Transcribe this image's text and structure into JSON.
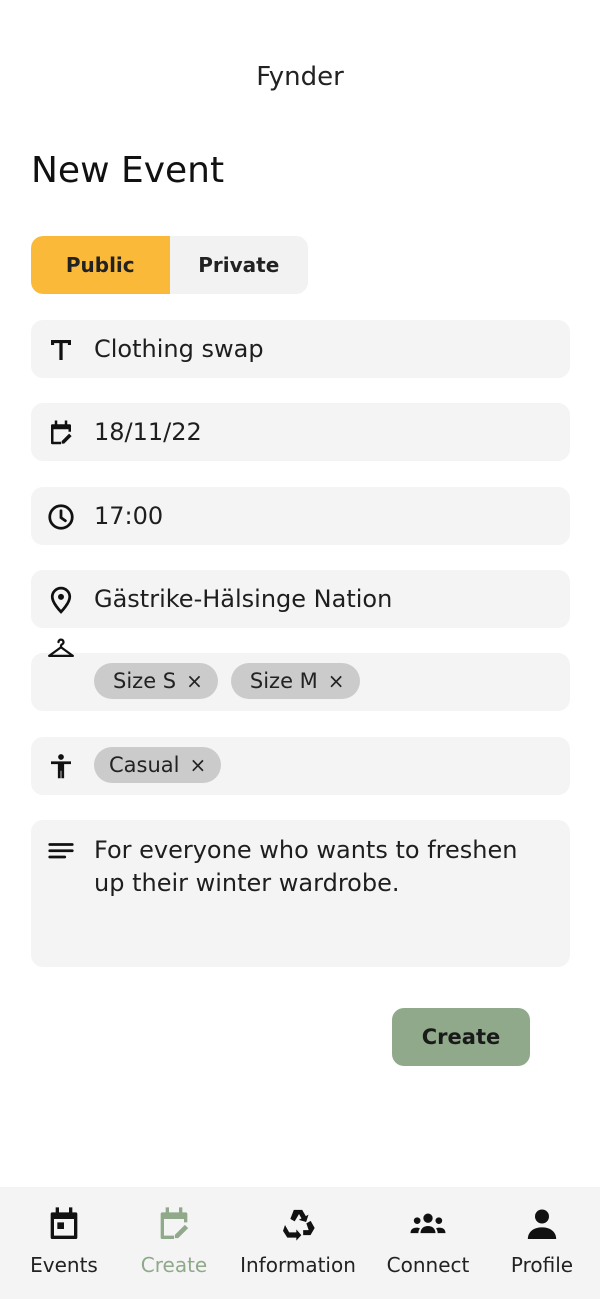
{
  "header": {
    "app_title": "Fynder"
  },
  "page": {
    "title": "New Event"
  },
  "visibility": {
    "options": [
      "Public",
      "Private"
    ],
    "selected": "Public",
    "active_color": "#fbb93a"
  },
  "form": {
    "title": "Clothing swap",
    "date": "18/11/22",
    "time": "17:00",
    "location": "Gästrike-Hälsinge Nation",
    "sizes": [
      "Size S",
      "Size M"
    ],
    "styles": [
      "Casual"
    ],
    "description": "For everyone who wants to freshen up their winter wardrobe.",
    "chip_remove_glyph": "×"
  },
  "actions": {
    "create_label": "Create",
    "create_color": "#8fa98a"
  },
  "bottom_nav": {
    "items": [
      {
        "label": "Events",
        "icon": "calendar-icon"
      },
      {
        "label": "Create",
        "icon": "calendar-edit-icon",
        "active": true
      },
      {
        "label": "Information",
        "icon": "recycle-icon"
      },
      {
        "label": "Connect",
        "icon": "group-icon"
      },
      {
        "label": "Profile",
        "icon": "person-icon"
      }
    ],
    "active_color": "#8fa98a"
  }
}
